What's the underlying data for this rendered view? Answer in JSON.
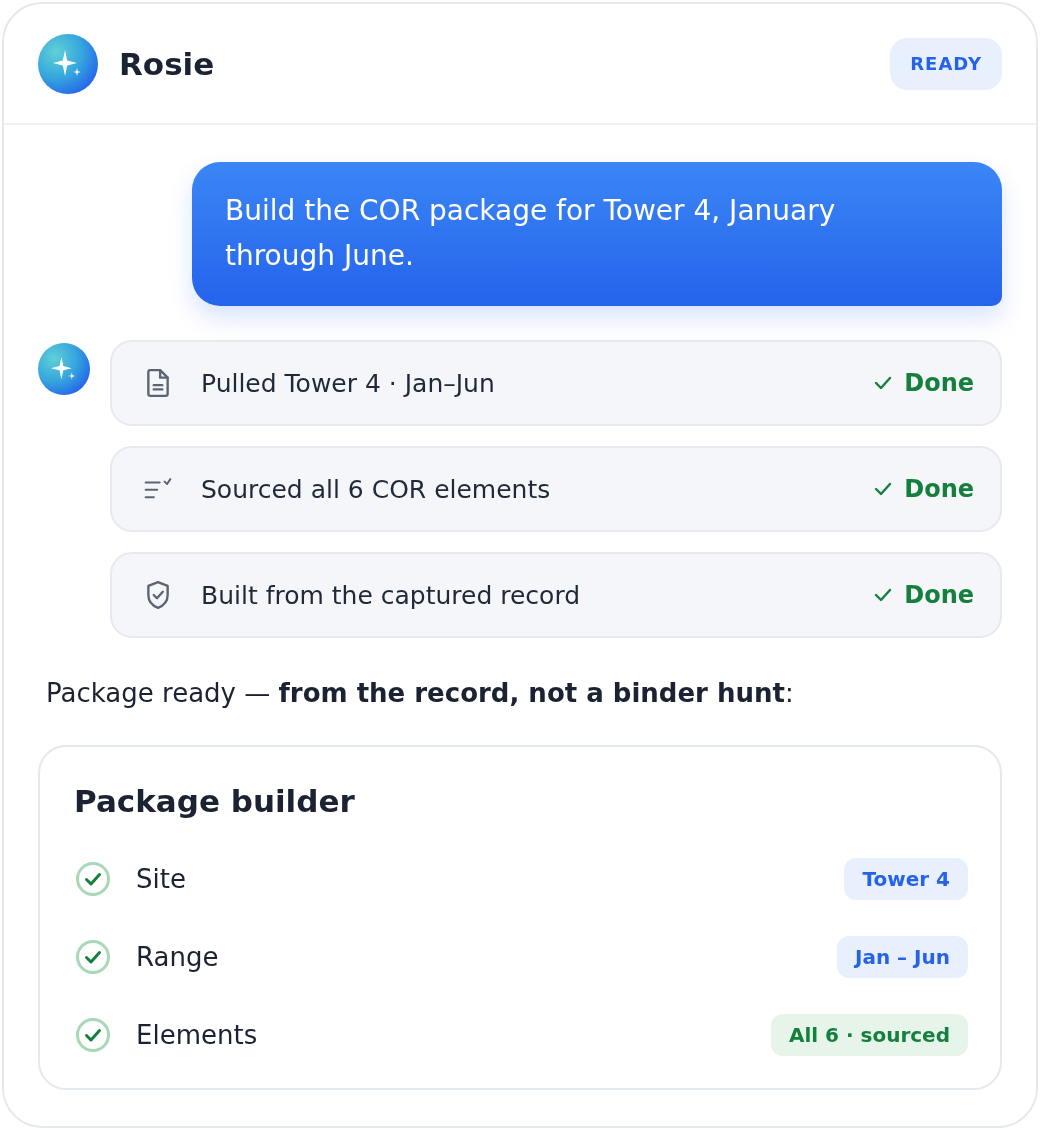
{
  "header": {
    "name": "Rosie",
    "status": "READY"
  },
  "user_message": "Build the COR package for Tower 4, January through June.",
  "steps": [
    {
      "kind": "document",
      "text": "Pulled Tower 4 · Jan–Jun",
      "status": "Done"
    },
    {
      "kind": "checklist",
      "text": "Sourced all 6 COR elements",
      "status": "Done"
    },
    {
      "kind": "shield",
      "text": "Built from the captured record",
      "status": "Done"
    }
  ],
  "summary": "Package ready — **from the record, not a binder hunt**:",
  "builder": {
    "title": "Package builder",
    "rows": [
      {
        "label": "Site",
        "value": "Tower 4",
        "kind": "info"
      },
      {
        "label": "Range",
        "value": "Jan – Jun",
        "kind": "info"
      },
      {
        "label": "Elements",
        "value": "All 6 · sourced",
        "kind": "success"
      }
    ]
  }
}
